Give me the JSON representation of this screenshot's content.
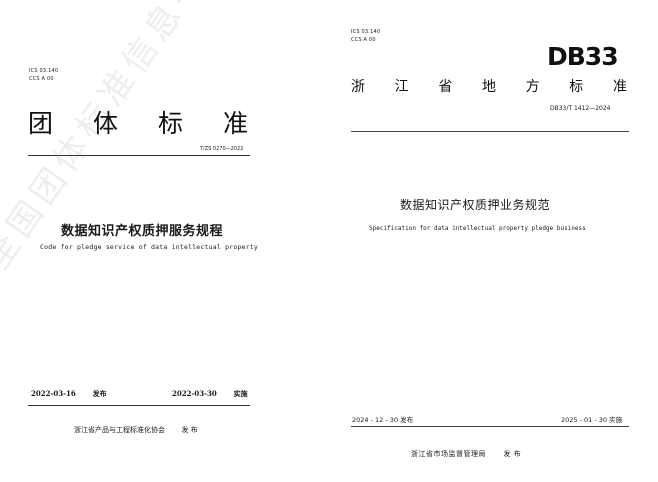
{
  "left": {
    "ics": "ICS  03.140",
    "ccs": "CCS   A 00",
    "category_chars": [
      "团",
      "体",
      "标",
      "准"
    ],
    "standard_no": "T/ZS 0270—2022",
    "title": "数据知识产权质押服务规程",
    "title_en": "Code for pledge service of data intellectual property",
    "publish_date": "2022-03-16",
    "publish_label": "发布",
    "implement_date": "2022-03-30",
    "implement_label": "实施",
    "issuer": "浙江省产品与工程标准化协会",
    "issuer_action": "发 布",
    "watermark": "全国团体标准信息平台"
  },
  "right": {
    "ics": "ICS  03.140",
    "ccs": "CCS   A 00",
    "logo": "DB33",
    "category_chars": [
      "浙",
      "江",
      "省",
      "地",
      "方",
      "标",
      "准"
    ],
    "standard_no": "DB33/T 1412—2024",
    "title": "数据知识产权质押业务规范",
    "title_en": "Specification for data intellectual property pledge business",
    "publish_date": "2024 - 12 - 30",
    "publish_label": "发布",
    "implement_date": "2025 - 01 - 30",
    "implement_label": "实施",
    "issuer": "浙江省市场监督管理局",
    "issuer_action": "发 布"
  }
}
